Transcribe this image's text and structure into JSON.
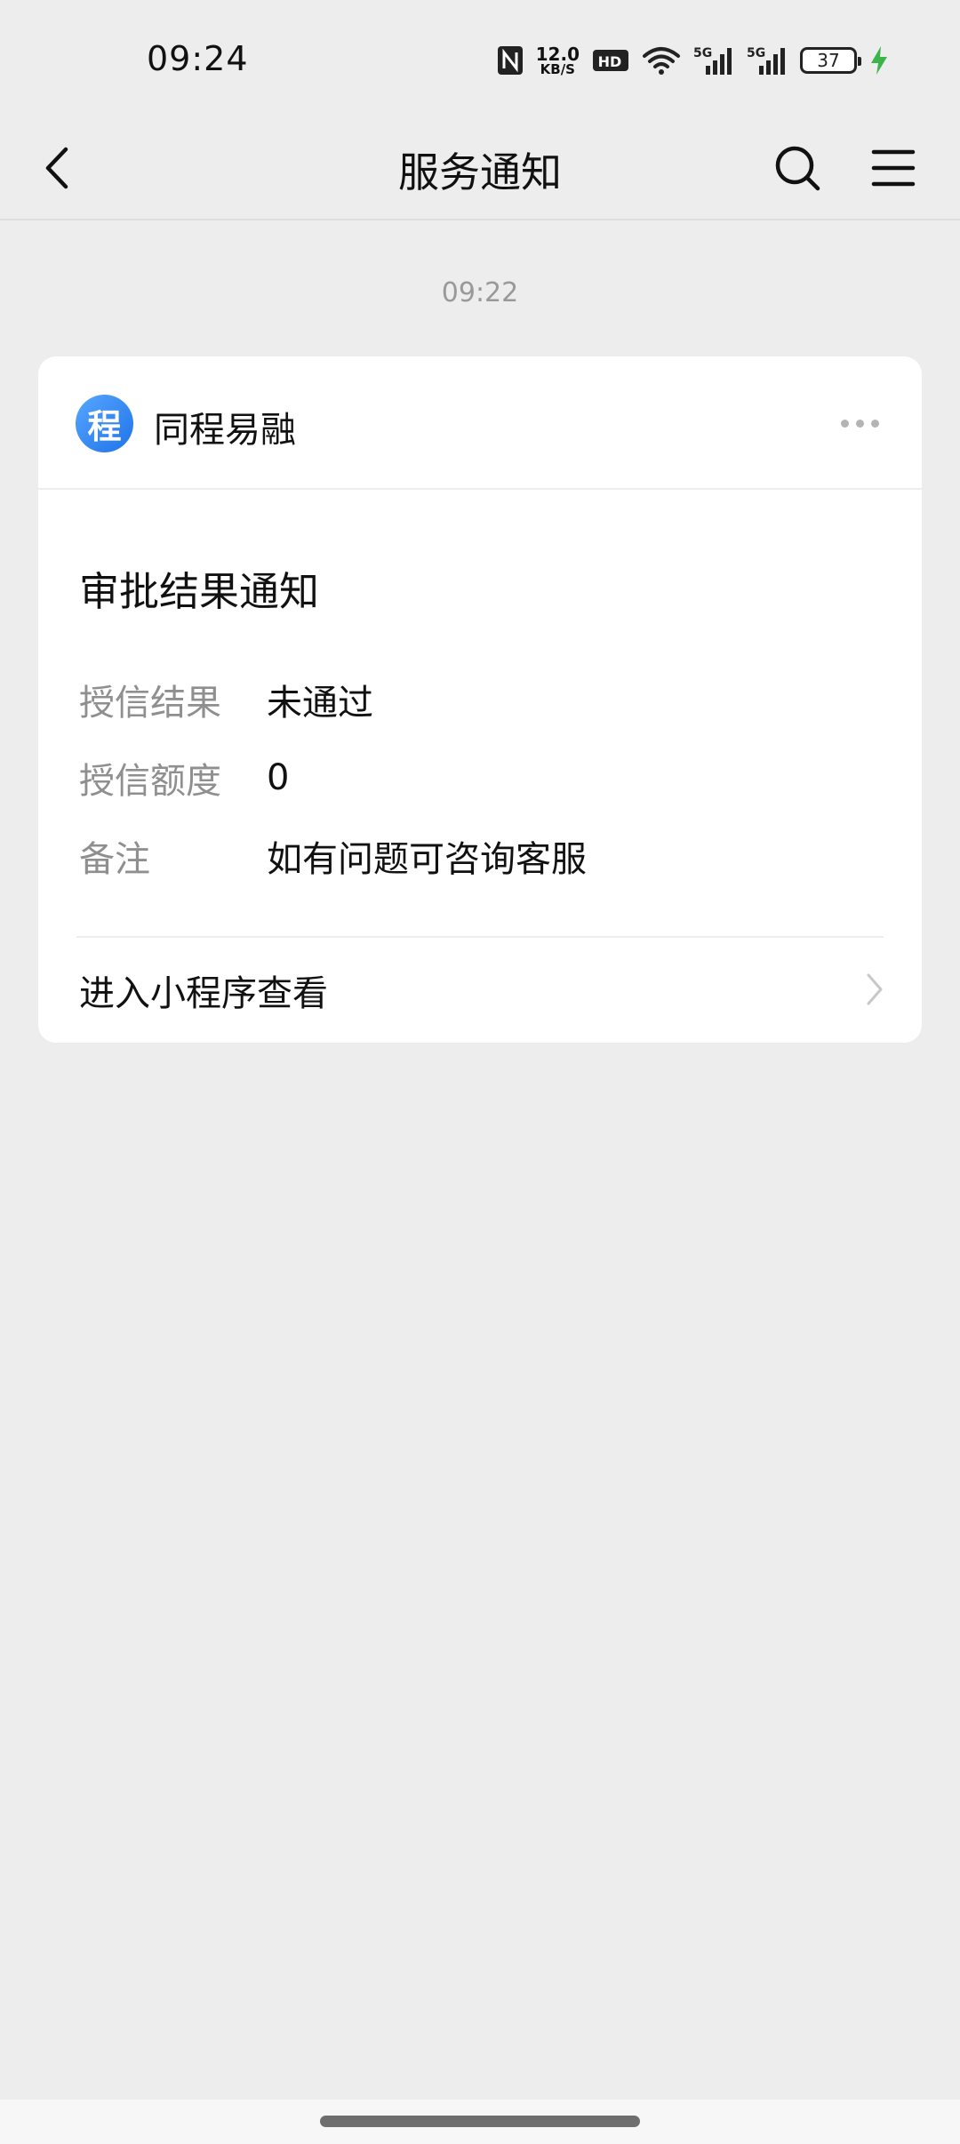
{
  "status_bar": {
    "time": "09:24",
    "network_speed_value": "12.0",
    "network_speed_unit": "KB/S",
    "hd_label": "HD",
    "signal_1_label": "5G",
    "signal_2_label": "5G",
    "battery_level": "37",
    "icons": [
      "nfc-icon",
      "hd-voice-icon",
      "wifi-icon",
      "signal-5g-icon",
      "signal-5g-icon",
      "battery-icon",
      "charging-icon"
    ],
    "charging_color": "#3bb54a"
  },
  "nav": {
    "title": "服务通知",
    "back_icon": "back-arrow-icon",
    "search_icon": "search-icon",
    "menu_icon": "menu-icon"
  },
  "message": {
    "time": "09:22",
    "app": {
      "name": "同程易融",
      "logo_char": "程",
      "logo_color": "#2f86f0"
    },
    "title": "审批结果通知",
    "fields": [
      {
        "label": "授信结果",
        "value": "未通过"
      },
      {
        "label": "授信额度",
        "value": "0"
      },
      {
        "label": "备注",
        "value": "如有问题可咨询客服"
      }
    ],
    "action_label": "进入小程序查看"
  },
  "colors": {
    "background": "#ededed",
    "card": "#ffffff",
    "secondary_text": "#8f8f8f"
  }
}
